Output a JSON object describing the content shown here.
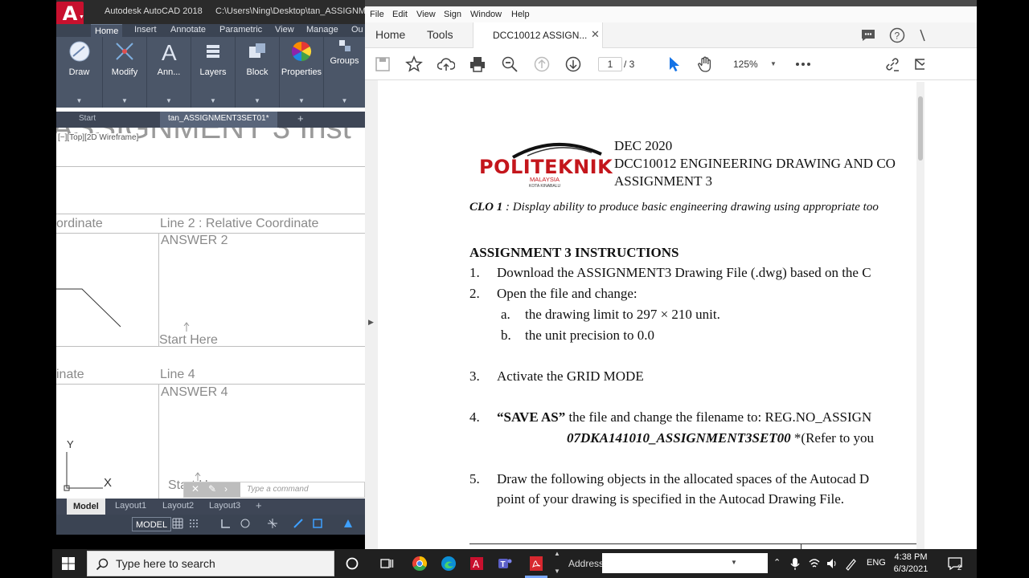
{
  "autocad": {
    "app_name": "Autodesk AutoCAD 2018",
    "path": "C:\\Users\\Ning\\Desktop\\tan_ASSIGNME",
    "ribbon_tabs": [
      "Home",
      "Insert",
      "Annotate",
      "Parametric",
      "View",
      "Manage",
      "Ou"
    ],
    "panels": [
      "Draw",
      "Modify",
      "Ann...",
      "Layers",
      "Block",
      "Properties",
      "Groups"
    ],
    "file_tabs": {
      "start": "Start",
      "active": "tan_ASSIGNMENT3SET01*"
    },
    "big_heading": "ASSIGNMENT 3 Inst",
    "viewport_label": "[−][Top][2D Wireframe]",
    "cells": {
      "left_header_1": "ordinate",
      "line2_header": "Line 2 : Relative Coordinate",
      "answer2": "ANSWER 2",
      "start_here_1": "Start Here",
      "left_header_2": "inate",
      "line4_header": "Line 4",
      "answer4": "ANSWER 4",
      "start_here_2": "Start Here"
    },
    "axis": {
      "y": "Y",
      "x": "X"
    },
    "command_placeholder": "Type a command",
    "layout_tabs": [
      "Model",
      "Layout1",
      "Layout2",
      "Layout3"
    ],
    "status_model": "MODEL"
  },
  "acrobat": {
    "menu": [
      "File",
      "Edit",
      "View",
      "Sign",
      "Window",
      "Help"
    ],
    "top_tabs": {
      "home": "Home",
      "tools": "Tools"
    },
    "doc_tab": "DCC10012 ASSIGN...",
    "page_current": "1",
    "page_total": "/ 3",
    "zoom": "125%",
    "document": {
      "header_lines": [
        "DEC 2020",
        "DCC10012 ENGINEERING DRAWING AND CO",
        "ASSIGNMENT 3"
      ],
      "logo_text": "POLITEKNIK",
      "logo_sub": "MALAYSIA",
      "logo_sub2": "KOTA KINABALU",
      "clo_label": "CLO 1",
      "clo_text": ":   Display ability to produce basic engineering drawing using appropriate too",
      "instructions_title": "ASSIGNMENT 3 INSTRUCTIONS",
      "items": [
        {
          "num": "1.",
          "text": "Download the ASSIGNMENT3 Drawing File (.dwg) based on the C"
        },
        {
          "num": "2.",
          "text": "Open the file and change:"
        },
        {
          "num": "a.",
          "text": "the drawing limit to 297 × 210 unit."
        },
        {
          "num": "b.",
          "text": "the unit precision to 0.0"
        },
        {
          "num": "3.",
          "text": "Activate the GRID MODE"
        },
        {
          "num": "4.",
          "text_bold": "“SAVE AS”",
          "text_rest": " the file and change the filename to: REG.NO_ASSIGN"
        },
        {
          "example_bold": "07DKA141010_ASSIGNMENT3SET00",
          "example_rest": " *(Refer to you"
        },
        {
          "num": "5.",
          "text": "Draw the following objects in the allocated spaces of the Autocad D"
        },
        {
          "text": "point of your drawing is specified in the Autocad Drawing File."
        }
      ]
    }
  },
  "taskbar": {
    "search_placeholder": "Type here to search",
    "address_label": "Address",
    "lang": "ENG",
    "time": "4:38 PM",
    "date": "6/3/2021",
    "notif_count": "2"
  },
  "colors": {
    "acad_red": "#c8102e",
    "ribbon": "#4b5668",
    "acrobat_blue": "#1473e6"
  }
}
